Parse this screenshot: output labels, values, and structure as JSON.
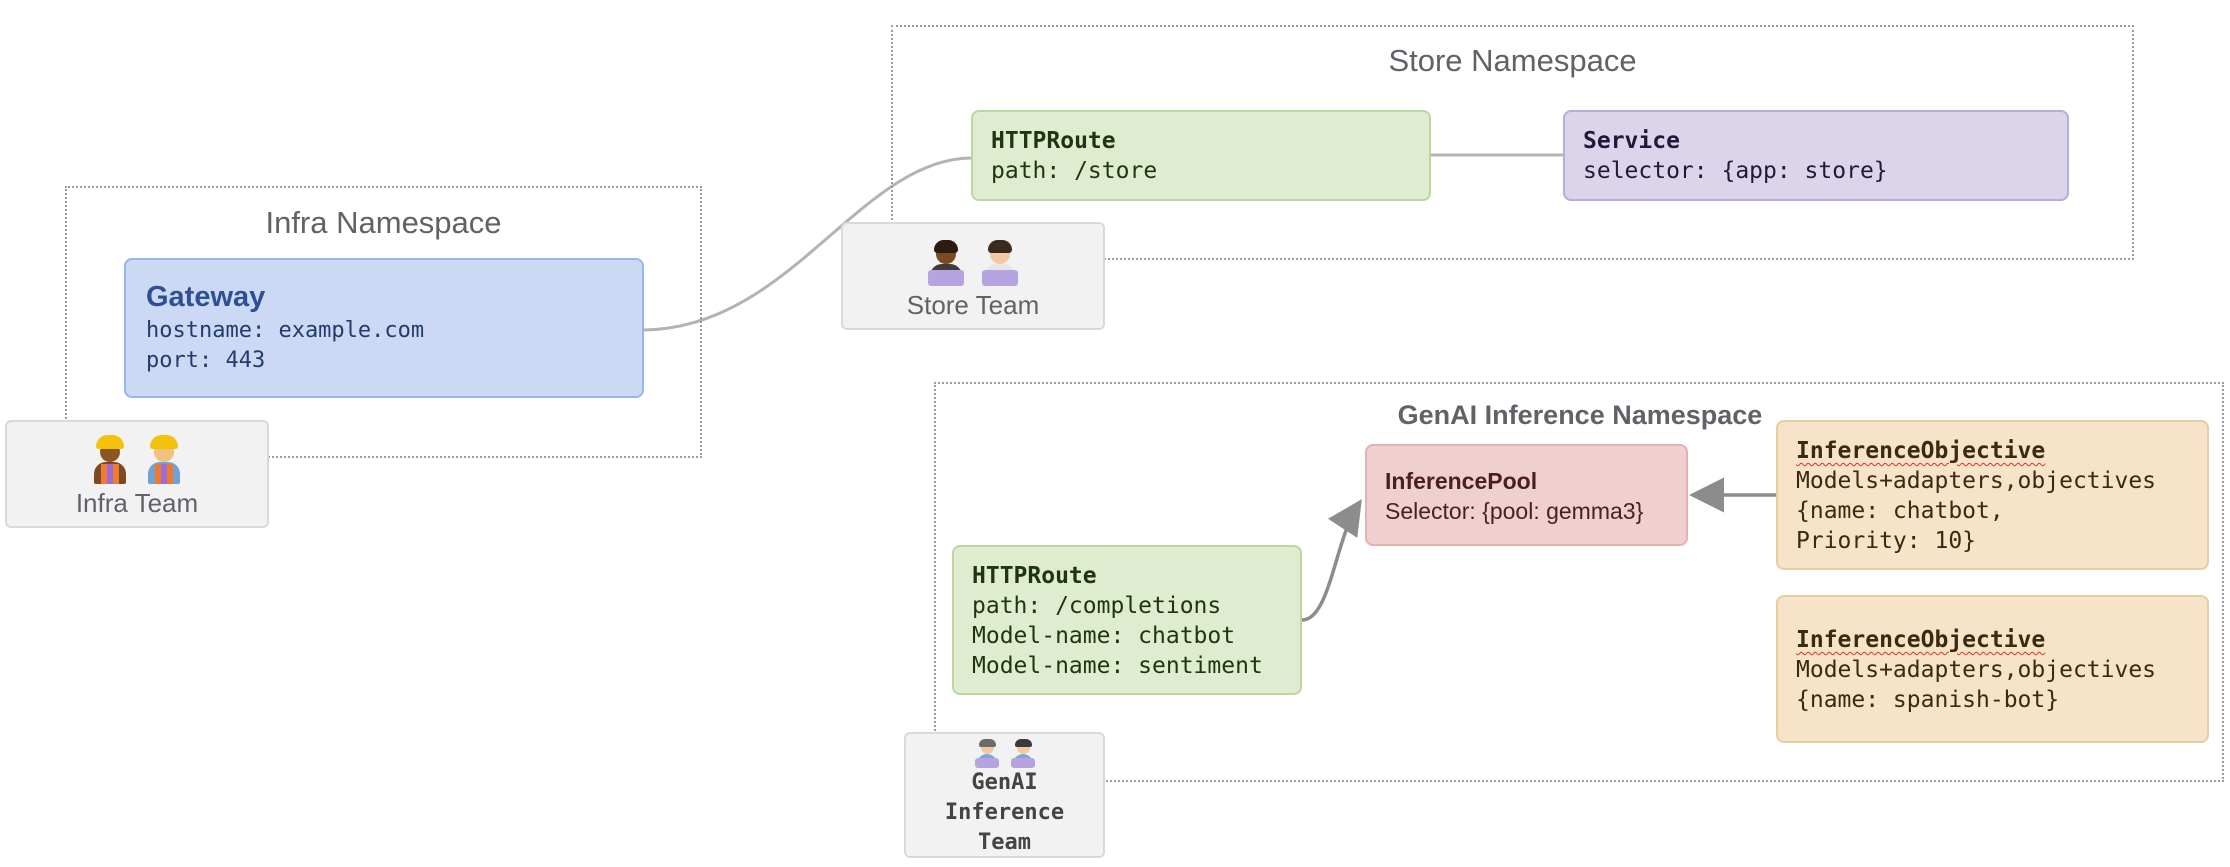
{
  "infra_namespace": {
    "title": "Infra Namespace",
    "gateway": {
      "kind": "Gateway",
      "hostname": "hostname: example.com",
      "port": "port: 443"
    },
    "team": {
      "label": "Infra Team",
      "avatars": [
        "construction-worker-woman-icon",
        "construction-worker-man-icon"
      ]
    }
  },
  "store_namespace": {
    "title": "Store Namespace",
    "httproute": {
      "kind": "HTTPRoute",
      "path": "path: /store"
    },
    "service": {
      "kind": "Service",
      "selector": "selector: {app: store}"
    },
    "team": {
      "label": "Store Team",
      "avatars": [
        "technologist-man-icon",
        "technologist-woman-icon"
      ]
    }
  },
  "genai_namespace": {
    "title": "GenAI Inference Namespace",
    "httproute": {
      "kind": "HTTPRoute",
      "lines": [
        "path: /completions",
        "Model-name: chatbot",
        "Model-name: sentiment"
      ]
    },
    "inference_pool": {
      "kind": "InferencePool",
      "selector": "Selector: {pool: gemma3}"
    },
    "objectives": [
      {
        "kind": "InferenceObjective",
        "lines": [
          "Models+adapters,objectives",
          "{name: chatbot,",
          "Priority: 10}"
        ]
      },
      {
        "kind": "InferenceObjective",
        "lines": [
          "Models+adapters,objectives",
          "{name: spanish-bot}"
        ]
      }
    ],
    "team": {
      "label_lines": [
        "GenAI",
        "Inference",
        "Team"
      ],
      "avatars": [
        "technologist-icon",
        "technologist-icon"
      ]
    }
  },
  "colors": {
    "gateway_fill": "#cbd9f5",
    "route_fill": "#dfeccf",
    "service_fill": "#dbd4ea",
    "pool_fill": "#efcfcf",
    "objective_fill": "#f6e3c8",
    "team_fill": "#f2f2f2",
    "connector": "#b3b3b3",
    "arrow": "#8c8c8c"
  }
}
